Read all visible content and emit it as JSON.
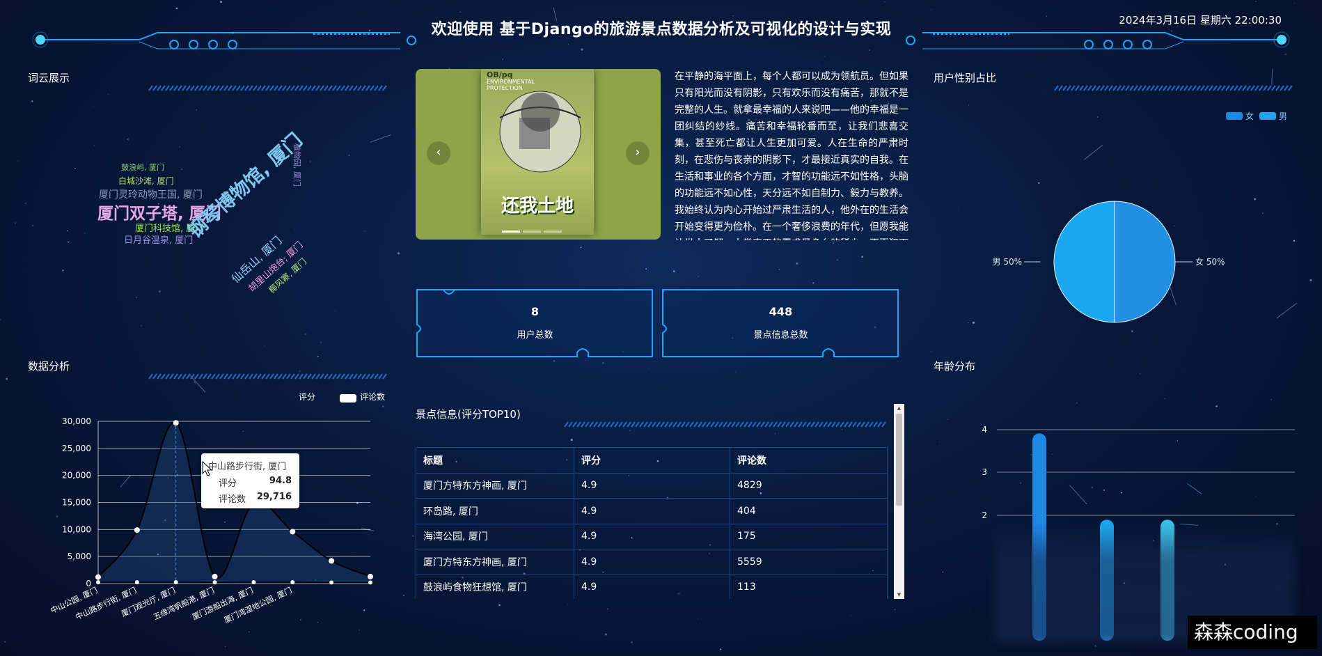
{
  "header": {
    "title": "欢迎使用 基于Django的旅游景点数据分析及可视化的设计与实现",
    "datetime": "2024年3月16日 星期六 22:00:30"
  },
  "panels": {
    "wordcloud_title": "词云展示",
    "gender_title": "用户性别占比",
    "data_title": "数据分析",
    "age_title": "年龄分布",
    "table_title": "景点信息(评分TOP10)"
  },
  "wordcloud": {
    "words": [
      {
        "text": "鼓浪屿, 厦门",
        "color": "#8fd36a"
      },
      {
        "text": "白城沙滩, 厦门",
        "color": "#b8d96a"
      },
      {
        "text": "厦门灵玲动物王国, 厦门",
        "color": "#8b9bb8"
      },
      {
        "text": "厦门双子塔, 厦门",
        "color": "#e6a8e6"
      },
      {
        "text": "厦门科技馆, 厦门",
        "color": "#9be05a"
      },
      {
        "text": "日月谷温泉, 厦门",
        "color": "#9a8fe0"
      },
      {
        "text": "钢琴博物馆, 厦门",
        "color": "#7ec8f0"
      },
      {
        "text": "仙岳山, 厦门",
        "color": "#8fd0f5"
      },
      {
        "text": "胡里山炮台, 厦门",
        "color": "#f09ad8"
      },
      {
        "text": "椰风寨, 厦门",
        "color": "#a8e07a"
      },
      {
        "text": "植物园, 厦门",
        "color": "#9a88d0"
      }
    ]
  },
  "carousel": {
    "prev_icon": "chevron-left-icon",
    "next_icon": "chevron-right-icon",
    "book_header": "OB/pq",
    "book_line1": "ENVIRONMENTAL",
    "book_line2": "PROTECTION",
    "book_title": "还我土地"
  },
  "intro": {
    "text": "在平静的海平面上，每个人都可以成为领航员。但如果只有阳光而没有阴影，只有欢乐而没有痛苦，那就不是完整的人生。就拿最幸福的人来说吧——他的幸福是一团纠结的纱线。痛苦和幸福轮番而至，让我们悲喜交集，甚至死亡都让人生更加可爱。人在生命的严肃时刻，在悲伤与丧亲的阴影下，才最接近真实的自我。在生活和事业的各个方面，才智的功能远不如性格，头脑的功能远不如心性，天分远不如自制力、毅力与教养。我始终认为内心开始过严肃生活的人，他外在的生活会开始变得更为俭朴。在一个奢侈浪费的年代，但愿我能让世人了解：人类真正的需求是多么的稀少。不再犯下"
  },
  "stats": [
    {
      "value": "8",
      "label": "用户总数"
    },
    {
      "value": "448",
      "label": "景点信息总数"
    }
  ],
  "gender_chart": {
    "type": "pie",
    "legend": [
      {
        "name": "女",
        "color": "#1e88e5"
      },
      {
        "name": "男",
        "color": "#1ea5ef"
      }
    ],
    "slices": [
      {
        "name": "女",
        "value": 50,
        "label": "女 50%",
        "color": "#2190e3"
      },
      {
        "name": "男",
        "value": 50,
        "label": "男 50%",
        "color": "#1aa7ef"
      }
    ]
  },
  "chart_data": [
    {
      "type": "line",
      "legend": [
        "评分",
        "评论数"
      ],
      "categories": [
        "中山公园, 厦门",
        "中山路步行街, 厦门",
        "厦门观光厅, 厦门",
        "五缘湾帆船港, 厦门",
        "厦门游船出海, 厦门",
        "厦门湾湿地公园, 厦门",
        "",
        ""
      ],
      "series": [
        {
          "name": "评论数",
          "values": [
            1200,
            9900,
            29716,
            1300,
            14900,
            9600,
            4200,
            1300
          ]
        },
        {
          "name": "评分",
          "values": [
            94.8,
            94.6,
            94.8,
            94.5,
            94.7,
            94.6,
            94.2,
            94.1
          ]
        }
      ],
      "ylim": [
        0,
        30000
      ],
      "yticks": [
        "0",
        "5,000",
        "10,000",
        "15,000",
        "20,000",
        "25,000",
        "30,000"
      ],
      "tooltip": {
        "title": "中山路步行街, 厦门",
        "label1": "评分",
        "value1": "94.8",
        "label2": "评论数",
        "value2": "29,716"
      }
    },
    {
      "type": "bar",
      "yticks": [
        "2",
        "3",
        "4"
      ],
      "ylim": [
        1.5,
        4
      ],
      "values": [
        3.9,
        1.9,
        1.9
      ]
    }
  ],
  "table": {
    "headers": [
      "标题",
      "评分",
      "评论数"
    ],
    "rows": [
      [
        "厦门方特东方神画, 厦门",
        "4.9",
        "4829"
      ],
      [
        "环岛路, 厦门",
        "4.9",
        "404"
      ],
      [
        "海湾公园, 厦门",
        "4.9",
        "175"
      ],
      [
        "厦门方特东方神画, 厦门",
        "4.9",
        "5559"
      ],
      [
        "鼓浪屿食物狂想馆, 厦门",
        "4.9",
        "113"
      ]
    ]
  },
  "watermark": "森森coding",
  "colors": {
    "accent": "#1e9bff",
    "bg": "#081a3d",
    "line": "#1d4a86"
  }
}
